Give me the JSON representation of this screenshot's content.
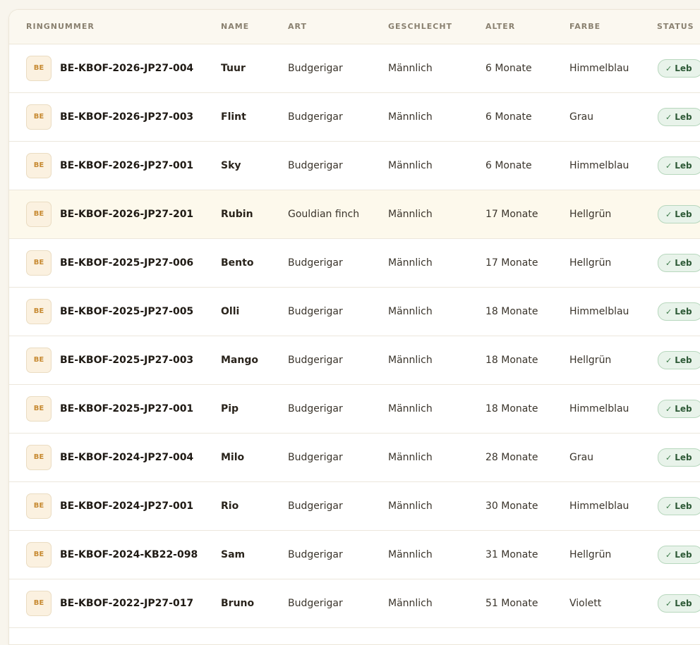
{
  "columns": {
    "ring": "RINGNUMMER",
    "name": "NAME",
    "art": "ART",
    "sex": "GESCHLECHT",
    "age": "ALTER",
    "color": "FARBE",
    "status": "STATUS"
  },
  "rows": [
    {
      "badge": "BE",
      "ring": "BE-KBOF-2026-JP27-004",
      "name": "Tuur",
      "art": "Budgerigar",
      "sex": "Männlich",
      "age": "6 Monate",
      "color": "Himmelblau",
      "status": "Leb"
    },
    {
      "badge": "BE",
      "ring": "BE-KBOF-2026-JP27-003",
      "name": "Flint",
      "art": "Budgerigar",
      "sex": "Männlich",
      "age": "6 Monate",
      "color": "Grau",
      "status": "Leb"
    },
    {
      "badge": "BE",
      "ring": "BE-KBOF-2026-JP27-001",
      "name": "Sky",
      "art": "Budgerigar",
      "sex": "Männlich",
      "age": "6 Monate",
      "color": "Himmelblau",
      "status": "Leb"
    },
    {
      "badge": "BE",
      "ring": "BE-KBOF-2026-JP27-201",
      "name": "Rubin",
      "art": "Gouldian finch",
      "sex": "Männlich",
      "age": "17 Monate",
      "color": "Hellgrün",
      "status": "Leb"
    },
    {
      "badge": "BE",
      "ring": "BE-KBOF-2025-JP27-006",
      "name": "Bento",
      "art": "Budgerigar",
      "sex": "Männlich",
      "age": "17 Monate",
      "color": "Hellgrün",
      "status": "Leb"
    },
    {
      "badge": "BE",
      "ring": "BE-KBOF-2025-JP27-005",
      "name": "Olli",
      "art": "Budgerigar",
      "sex": "Männlich",
      "age": "18 Monate",
      "color": "Himmelblau",
      "status": "Leb"
    },
    {
      "badge": "BE",
      "ring": "BE-KBOF-2025-JP27-003",
      "name": "Mango",
      "art": "Budgerigar",
      "sex": "Männlich",
      "age": "18 Monate",
      "color": "Hellgrün",
      "status": "Leb"
    },
    {
      "badge": "BE",
      "ring": "BE-KBOF-2025-JP27-001",
      "name": "Pip",
      "art": "Budgerigar",
      "sex": "Männlich",
      "age": "18 Monate",
      "color": "Himmelblau",
      "status": "Leb"
    },
    {
      "badge": "BE",
      "ring": "BE-KBOF-2024-JP27-004",
      "name": "Milo",
      "art": "Budgerigar",
      "sex": "Männlich",
      "age": "28 Monate",
      "color": "Grau",
      "status": "Leb"
    },
    {
      "badge": "BE",
      "ring": "BE-KBOF-2024-JP27-001",
      "name": "Rio",
      "art": "Budgerigar",
      "sex": "Männlich",
      "age": "30 Monate",
      "color": "Himmelblau",
      "status": "Leb"
    },
    {
      "badge": "BE",
      "ring": "BE-KBOF-2024-KB22-098",
      "name": "Sam",
      "art": "Budgerigar",
      "sex": "Männlich",
      "age": "31 Monate",
      "color": "Hellgrün",
      "status": "Leb"
    },
    {
      "badge": "BE",
      "ring": "BE-KBOF-2022-JP27-017",
      "name": "Bruno",
      "art": "Budgerigar",
      "sex": "Männlich",
      "age": "51 Monate",
      "color": "Violett",
      "status": "Leb"
    }
  ],
  "colors": {
    "badge_bg": "#fbf1e0",
    "badge_text": "#c78a32",
    "status_bg": "#e8f3ea",
    "status_border": "#b7d7bd",
    "highlight_row": "#fdf9ec"
  },
  "icons": {
    "status": "check-icon"
  }
}
